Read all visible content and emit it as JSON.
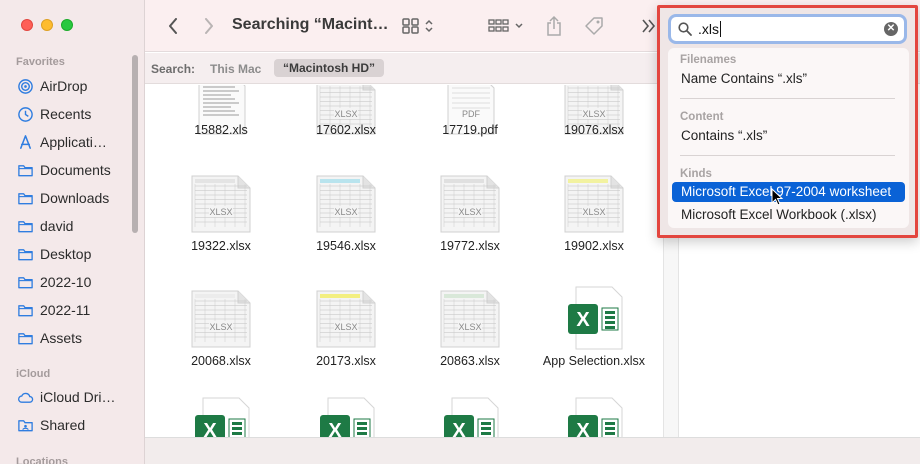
{
  "toolbar": {
    "title": "Searching “Macint…",
    "back_icon": "chevron-left",
    "forward_icon": "chevron-right",
    "view_icon": "grid-view",
    "group_icon": "group-by",
    "share_icon": "share",
    "tag_icon": "tag",
    "more_icon": "double-chevron-right"
  },
  "sidebar": {
    "favorites_header": "Favorites",
    "items": [
      {
        "label": "AirDrop",
        "icon": "airdrop-icon"
      },
      {
        "label": "Recents",
        "icon": "clock-icon"
      },
      {
        "label": "Applicati…",
        "icon": "applications-icon"
      },
      {
        "label": "Documents",
        "icon": "folder-icon"
      },
      {
        "label": "Downloads",
        "icon": "folder-icon"
      },
      {
        "label": "david",
        "icon": "folder-icon"
      },
      {
        "label": "Desktop",
        "icon": "folder-icon"
      },
      {
        "label": "2022-10",
        "icon": "folder-icon"
      },
      {
        "label": "2022-11",
        "icon": "folder-icon"
      },
      {
        "label": "Assets",
        "icon": "folder-icon"
      }
    ],
    "icloud_header": "iCloud",
    "icloud_items": [
      {
        "label": "iCloud Dri…",
        "icon": "cloud-icon"
      },
      {
        "label": "Shared",
        "icon": "shared-folder-icon"
      }
    ],
    "locations_header": "Locations"
  },
  "scope": {
    "label": "Search:",
    "this_mac": "This Mac",
    "selected": "“Macintosh HD”"
  },
  "files": [
    {
      "name": "15882.xls",
      "kind": "doc"
    },
    {
      "name": "17602.xlsx",
      "kind": "xlsx"
    },
    {
      "name": "17719.pdf",
      "kind": "pdf"
    },
    {
      "name": "19076.xlsx",
      "kind": "xlsx"
    },
    {
      "name": "19322.xlsx",
      "kind": "xlsx"
    },
    {
      "name": "19546.xlsx",
      "kind": "xlsx"
    },
    {
      "name": "19772.xlsx",
      "kind": "xlsx"
    },
    {
      "name": "19902.xlsx",
      "kind": "xlsx"
    },
    {
      "name": "20068.xlsx",
      "kind": "xlsx"
    },
    {
      "name": "20173.xlsx",
      "kind": "xlsx"
    },
    {
      "name": "20863.xlsx",
      "kind": "xlsx"
    },
    {
      "name": "App Selection.xlsx",
      "kind": "excel-app"
    }
  ],
  "thumb_labels": {
    "xlsx": "XLSX",
    "pdf": "PDF"
  },
  "search": {
    "query": ".xls",
    "clear_icon": "clear-icon",
    "sections": {
      "filenames": "Filenames",
      "content": "Content",
      "kinds": "Kinds"
    },
    "filenames_item": "Name Contains “.xls”",
    "content_item": "Contains “.xls”",
    "kinds_items": [
      "Microsoft Excel 97-2004 worksheet",
      "Microsoft Excel Workbook (.xlsx)"
    ],
    "selected_index": 0
  },
  "colors": {
    "highlight": "#0a62d6",
    "frame_red": "#e3463f",
    "excel_green": "#1e7a45",
    "sidebar_icon": "#2f7de0"
  }
}
